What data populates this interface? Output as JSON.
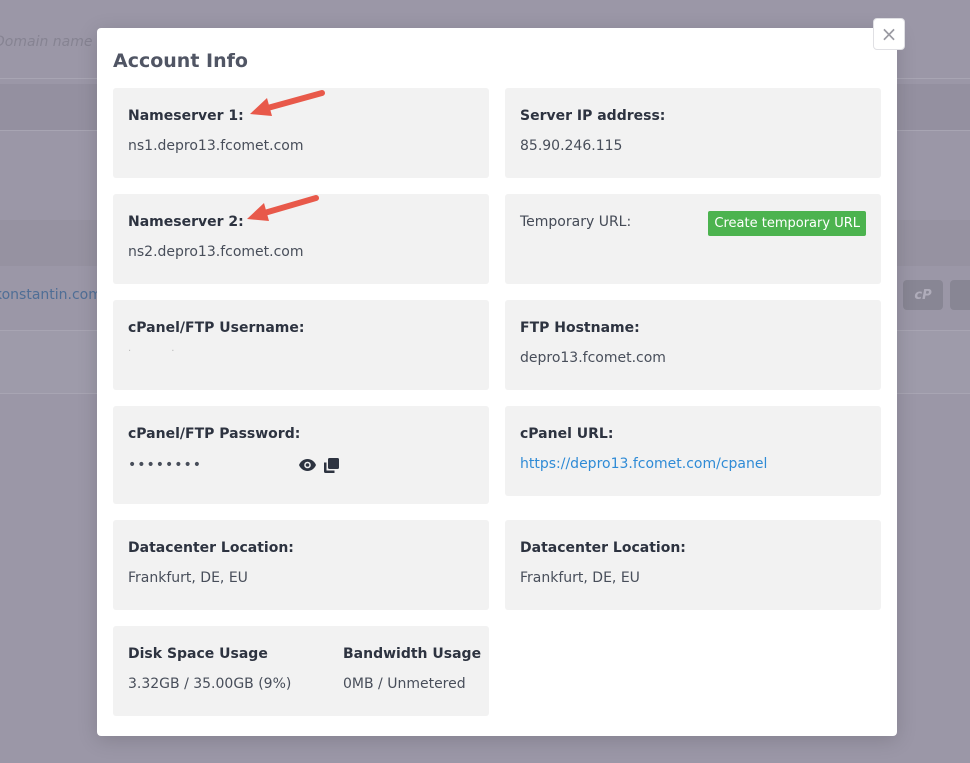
{
  "background": {
    "search_placeholder": "Domain name ...",
    "domain_link": "konstantin.com",
    "cp_button": "cP"
  },
  "modal": {
    "title": "Account Info",
    "close_label": "×",
    "nameserver1": {
      "label": "Nameserver 1:",
      "value": "ns1.depro13.fcomet.com"
    },
    "nameserver2": {
      "label": "Nameserver 2:",
      "value": "ns2.depro13.fcomet.com"
    },
    "server_ip": {
      "label": "Server IP address:",
      "value": "85.90.246.115"
    },
    "temporary_url": {
      "label": "Temporary URL:",
      "button": "Create temporary URL"
    },
    "cpanel_username": {
      "label": "cPanel/FTP Username:"
    },
    "ftp_hostname": {
      "label": "FTP Hostname:",
      "value": "depro13.fcomet.com"
    },
    "cpanel_password": {
      "label": "cPanel/FTP Password:",
      "value": "••••••••"
    },
    "cpanel_url": {
      "label": "cPanel URL:",
      "value": "https://depro13.fcomet.com/cpanel"
    },
    "datacenter_left": {
      "label": "Datacenter Location:",
      "value": "Frankfurt, DE, EU"
    },
    "datacenter_right": {
      "label": "Datacenter Location:",
      "value": "Frankfurt, DE, EU"
    },
    "disk_usage": {
      "label": "Disk Space Usage",
      "value": "3.32GB / 35.00GB (9%)"
    },
    "bandwidth_usage": {
      "label": "Bandwidth Usage",
      "value": "0MB / Unmetered"
    }
  },
  "colors": {
    "accent_green": "#4cb34f",
    "link_blue": "#2f8bd6",
    "arrow_red": "#e8594a"
  },
  "icons": [
    "close-icon",
    "eye-icon",
    "copy-icon",
    "arrow-pointer-icon"
  ]
}
